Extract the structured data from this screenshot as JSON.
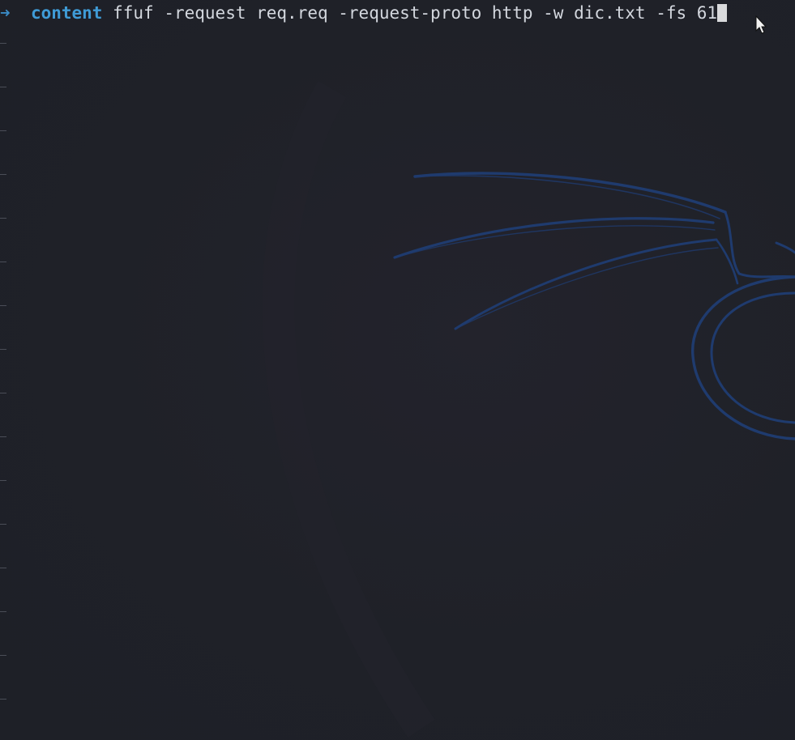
{
  "terminal": {
    "prompt_arrow": "➜",
    "current_directory": "content",
    "command": "ffuf -request req.req -request-proto http -w dic.txt -fs 61",
    "cursor_icon": "block-cursor",
    "pointer_icon": "mouse-pointer-icon"
  },
  "wallpaper": {
    "logo_icon": "kali-dragon-icon",
    "logo_color": "#1f3b6e"
  },
  "colors": {
    "background": "#1f2128",
    "prompt_accent": "#3f9bd6",
    "text": "#d3d7de"
  }
}
